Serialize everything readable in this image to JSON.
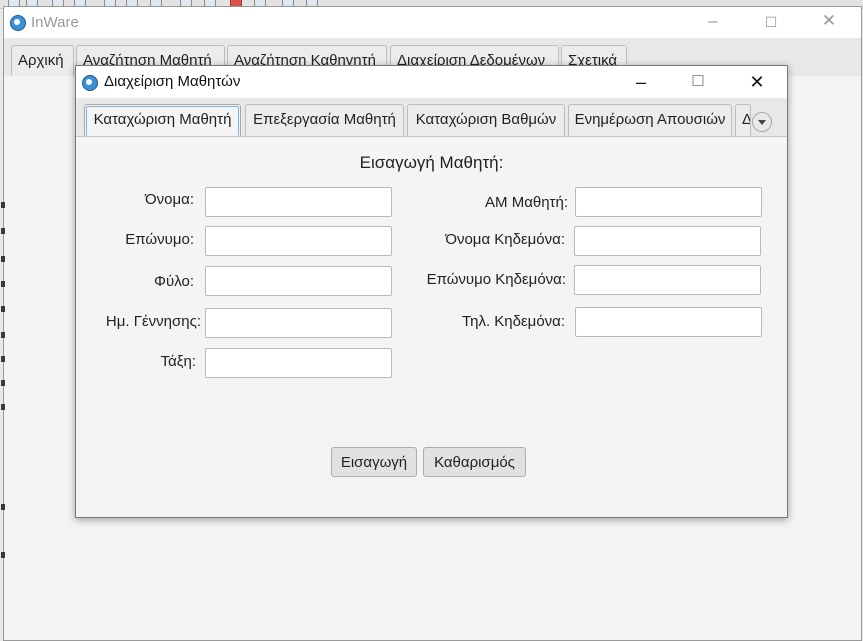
{
  "main_window": {
    "title": "InWare",
    "tabs": [
      {
        "label": "Αρχική"
      },
      {
        "label": "Αναζήτηση Μαθητή"
      },
      {
        "label": "Αναζήτηση Καθηγητή"
      },
      {
        "label": "Διαχείριση Δεδομένων"
      },
      {
        "label": "Σχετικά"
      }
    ]
  },
  "window_controls": {
    "minimize": "–",
    "maximize": "☐",
    "close": "✕"
  },
  "dialog": {
    "title": "Διαχείριση Μαθητών",
    "tabs": [
      {
        "label": "Καταχώριση Μαθητή"
      },
      {
        "label": "Επεξεργασία Μαθητή"
      },
      {
        "label": "Καταχώριση Βαθμών"
      },
      {
        "label": "Ενημέρωση Απουσιών"
      },
      {
        "label": "Δ"
      }
    ],
    "form": {
      "heading": "Εισαγωγή Μαθητή:",
      "left_fields": [
        {
          "label": "Όνομα:",
          "value": ""
        },
        {
          "label": "Επώνυμο:",
          "value": ""
        },
        {
          "label": "Φύλο:",
          "value": ""
        },
        {
          "label": "Ημ. Γέννησης:",
          "value": ""
        },
        {
          "label": "Τάξη:",
          "value": ""
        }
      ],
      "right_fields": [
        {
          "label": "ΑΜ Μαθητή:",
          "value": ""
        },
        {
          "label": "Όνομα Κηδεμόνα:",
          "value": ""
        },
        {
          "label": "Επώνυμο Κηδεμόνα:",
          "value": ""
        },
        {
          "label": "Τηλ. Κηδεμόνα:",
          "value": ""
        }
      ],
      "insert_button": "Εισαγωγή",
      "clear_button": "Καθαρισμός"
    }
  }
}
